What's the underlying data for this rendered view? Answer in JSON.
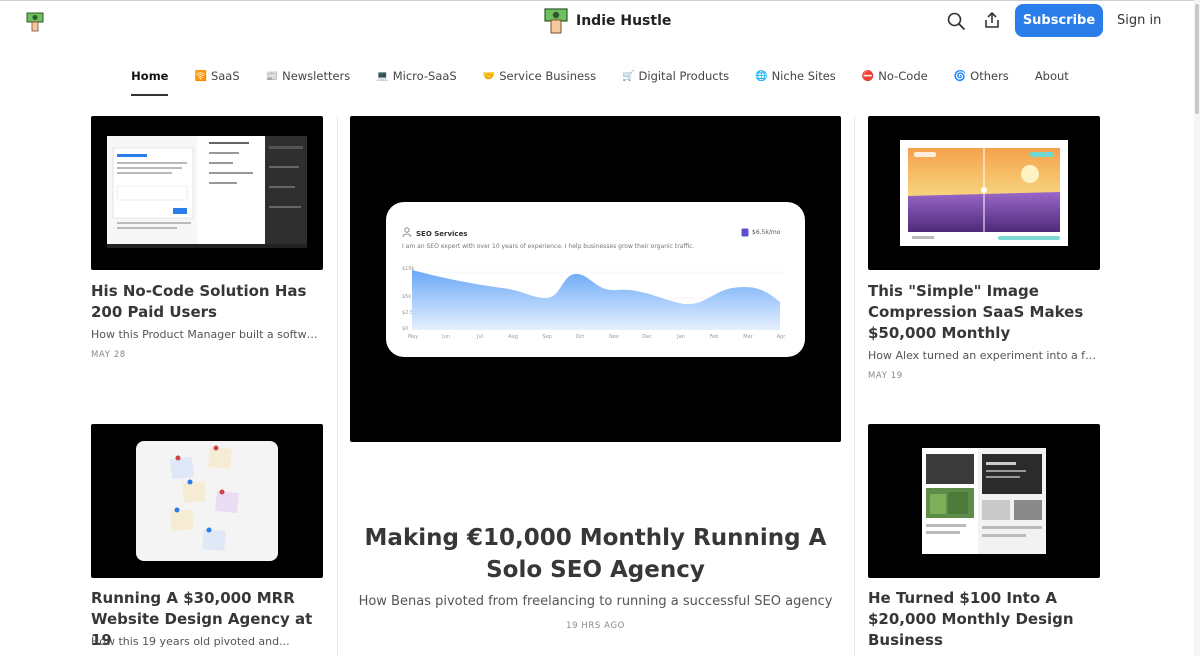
{
  "header": {
    "brand_name": "Indie Hustle",
    "subscribe_label": "Subscribe",
    "signin_label": "Sign in",
    "accent_color": "#2b7de9"
  },
  "nav": {
    "items": [
      {
        "label": "Home",
        "emoji": "",
        "active": true
      },
      {
        "label": "SaaS",
        "emoji": "🛜"
      },
      {
        "label": "Newsletters",
        "emoji": "📰"
      },
      {
        "label": "Micro-SaaS",
        "emoji": "💻"
      },
      {
        "label": "Service Business",
        "emoji": "🤝"
      },
      {
        "label": "Digital Products",
        "emoji": "🛒"
      },
      {
        "label": "Niche Sites",
        "emoji": "🌐"
      },
      {
        "label": "No-Code",
        "emoji": "⛔"
      },
      {
        "label": "Others",
        "emoji": "🌀"
      },
      {
        "label": "About",
        "emoji": ""
      }
    ]
  },
  "posts": {
    "left_top": {
      "title": "His No-Code Solution Has 200 Paid Users",
      "subtitle": "How this Product Manager built a softwar...",
      "date": "MAY 28"
    },
    "left_bottom": {
      "title": "Running A $30,000 MRR Website Design Agency at 19",
      "subtitle": "How this 19 years old pivoted and..."
    },
    "hero": {
      "title": "Making €10,000 Monthly Running A Solo SEO Agency",
      "subtitle": "How Benas pivoted from freelancing to running a successful SEO agency",
      "date": "19 HRS AGO",
      "image": {
        "label": "SEO Services",
        "description": "I am an SEO expert with over 10 years of experience. I help businesses grow their organic traffic.",
        "price": "$6.5k/mo",
        "y_ticks": [
          "$10k",
          "$5k",
          "$2.5k",
          "$0"
        ],
        "x_ticks": [
          "May",
          "Jun",
          "Jul",
          "Aug",
          "Sep",
          "Oct",
          "Nov",
          "Dec",
          "Jan",
          "Feb",
          "Mar",
          "Apr"
        ]
      }
    },
    "right_top": {
      "title": "This \"Simple\" Image Compression SaaS Makes $50,000 Monthly",
      "subtitle": "How Alex turned an experiment into a full-...",
      "date": "MAY 19"
    },
    "right_bottom": {
      "title": "He Turned $100 Into A $20,000 Monthly Design Business"
    }
  }
}
